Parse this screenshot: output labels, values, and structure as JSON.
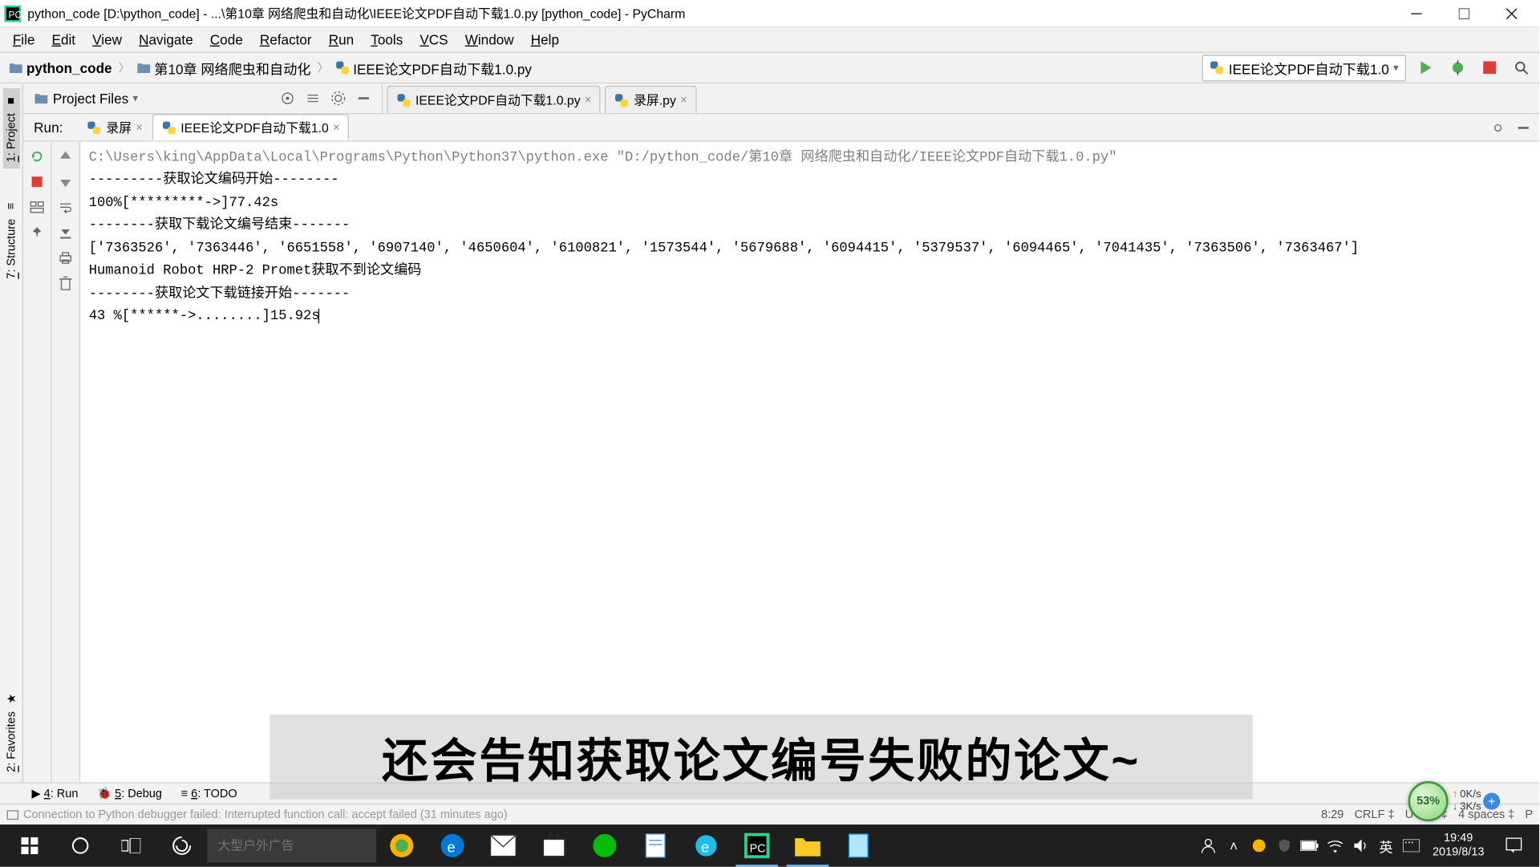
{
  "titlebar": {
    "text": "python_code [D:\\python_code] - ...\\第10章 网络爬虫和自动化\\IEEE论文PDF自动下载1.0.py [python_code] - PyCharm"
  },
  "menu": [
    "File",
    "Edit",
    "View",
    "Navigate",
    "Code",
    "Refactor",
    "Run",
    "Tools",
    "VCS",
    "Window",
    "Help"
  ],
  "breadcrumb": {
    "items": [
      {
        "icon": "folder",
        "text": "python_code",
        "bold": true
      },
      {
        "icon": "folder",
        "text": "第10章 网络爬虫和自动化"
      },
      {
        "icon": "py",
        "text": "IEEE论文PDF自动下载1.0.py"
      }
    ]
  },
  "run_config_selected": "IEEE论文PDF自动下载1.0",
  "project_header": {
    "title": "Project Files"
  },
  "editor_tabs": [
    {
      "label": "IEEE论文PDF自动下载1.0.py",
      "active": false
    },
    {
      "label": "录屏.py",
      "active": false
    }
  ],
  "left_tabs": [
    {
      "label": "1: Project",
      "icon": "■"
    },
    {
      "label": "7: Structure",
      "icon": "≡"
    },
    {
      "label": "2: Favorites",
      "icon": "★"
    }
  ],
  "run": {
    "label": "Run:",
    "tabs": [
      {
        "label": "录屏",
        "active": false
      },
      {
        "label": "IEEE论文PDF自动下载1.0",
        "active": true
      }
    ]
  },
  "console_lines": [
    {
      "cls": "gray",
      "text": "C:\\Users\\king\\AppData\\Local\\Programs\\Python\\Python37\\python.exe \"D:/python_code/第10章 网络爬虫和自动化/IEEE论文PDF自动下载1.0.py\""
    },
    {
      "cls": "",
      "text": "---------获取论文编码开始--------"
    },
    {
      "cls": "",
      "text": "100%[*********->]77.42s"
    },
    {
      "cls": "",
      "text": "--------获取下载论文编号结束-------"
    },
    {
      "cls": "",
      "text": "['7363526', '7363446', '6651558', '6907140', '4650604', '6100821', '1573544', '5679688', '6094415', '5379537', '6094465', '7041435', '7363506', '7363467']"
    },
    {
      "cls": "",
      "text": "Humanoid Robot HRP-2 Promet获取不到论文编码"
    },
    {
      "cls": "",
      "text": "--------获取论文下载链接开始-------"
    },
    {
      "cls": "",
      "text": "43 %[******->........]15.92s",
      "cursor": true
    }
  ],
  "bottom_tabs": [
    {
      "icon": "▶",
      "label": "4: Run",
      "underline": "4"
    },
    {
      "icon": "🐞",
      "label": "5: Debug",
      "underline": "5"
    },
    {
      "icon": "≡",
      "label": "6: TODO",
      "underline": "6"
    }
  ],
  "statusbar": {
    "left": "Connection to Python debugger failed: Interrupted function call: accept failed (31 minutes ago)",
    "right": {
      "pos": "8:29",
      "eol": "CRLF",
      "enc": "UTF-8",
      "indent": "4 spaces",
      "extra": "P"
    }
  },
  "overlay": "还会告知获取论文编号失败的论文~",
  "netwidget": {
    "pct": "53%",
    "up": "0K/s",
    "down": "3K/s"
  },
  "taskbar": {
    "search_placeholder": "大型户外广告",
    "ime": "英",
    "clock": {
      "time": "19:49",
      "date": "2019/8/13"
    }
  }
}
